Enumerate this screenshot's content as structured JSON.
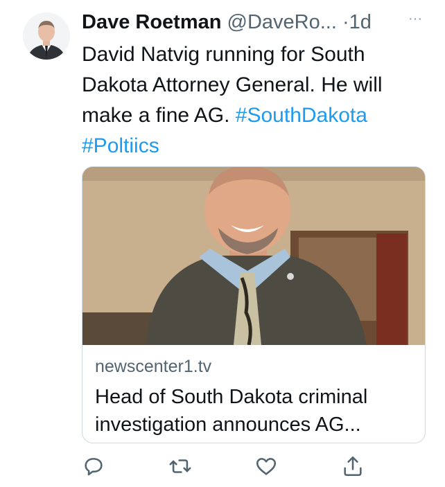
{
  "tweet": {
    "author_name": "Dave Roetman",
    "handle": "@DaveRo...",
    "separator": "·",
    "time": "1d",
    "more_label": "···",
    "text_plain": "David Natvig running for South Dakota Attorney General. He will make a fine AG.",
    "hashtag_1": "#SouthDakota",
    "hashtag_2": "#Poltiics"
  },
  "card": {
    "domain": "newscenter1.tv",
    "title": "Head of South Dakota criminal investigation announces AG..."
  },
  "actions": {
    "icons": [
      "reply-icon",
      "retweet-icon",
      "like-icon",
      "share-icon"
    ]
  },
  "colors": {
    "link": "#1d9bf0",
    "secondary_text": "#536471",
    "primary_text": "#0f1419",
    "border": "#cfd9de"
  }
}
